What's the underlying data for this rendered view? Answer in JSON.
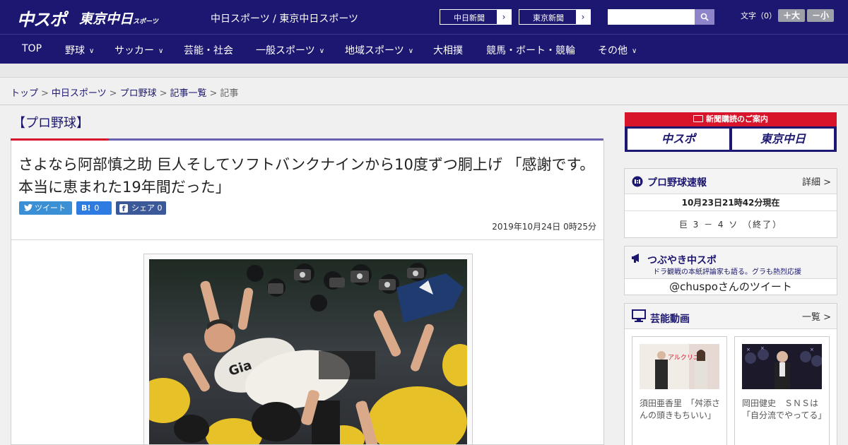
{
  "header": {
    "logo_main": "中スポ",
    "logo_tokyo": "東京中日",
    "logo_tokyo_small": "スポーツ",
    "site_title": "中日スポーツ / 東京中日スポーツ",
    "chunichi_btn": "中日新聞",
    "tokyo_btn": "東京新聞",
    "search_placeholder": "",
    "font_label": "文字（0）",
    "font_up": "＋大",
    "font_down": "－小"
  },
  "nav": [
    {
      "label": "TOP",
      "chevron": false
    },
    {
      "label": "野球",
      "chevron": true
    },
    {
      "label": "サッカー",
      "chevron": true
    },
    {
      "label": "芸能・社会",
      "chevron": false
    },
    {
      "label": "一般スポーツ",
      "chevron": true
    },
    {
      "label": "地域スポーツ",
      "chevron": true
    },
    {
      "label": "大相撲",
      "chevron": false
    },
    {
      "label": "競馬・ボート・競輪",
      "chevron": false
    },
    {
      "label": "その他",
      "chevron": true
    }
  ],
  "breadcrumb": {
    "items": [
      "トップ",
      "中日スポーツ",
      "プロ野球",
      "記事一覧"
    ],
    "current": "記事",
    "separator": ">"
  },
  "article": {
    "category": "【プロ野球】",
    "headline": "さよなら阿部慎之助 巨人そしてソフトバンクナインから10度ずつ胴上げ 「感謝です。本当に恵まれた19年間だった」",
    "tweet_label": "ツイート",
    "hatena_count": "0",
    "share_label": "シェア",
    "share_count": "0",
    "datetime": "2019年10月24日 0時25分"
  },
  "sidebar": {
    "promo_title": "新聞購読のご案内",
    "promo_logo_1": "中スポ",
    "promo_logo_2": "東京中日",
    "score": {
      "title": "プロ野球速報",
      "more": "詳細 >",
      "time": "10月23日21時42分現在",
      "line": "巨 3 － 4 ソ （終了）"
    },
    "tsubuyaki": {
      "title": "つぶやき中スポ",
      "sub": "ドラ観戦の本紙評論家も語る。グラも熱烈応援",
      "tweets": "@chuspoさんのツイート"
    },
    "video": {
      "title": "芸能動画",
      "more": "一覧 >",
      "items": [
        {
          "caption": "須田亜香里　「舛添さんの頭きもちいい」"
        },
        {
          "caption": "岡田健史　ＳＮＳは「自分流でやってる」"
        }
      ]
    }
  },
  "colors": {
    "brand": "#1c1770",
    "accent_red": "#d7142a",
    "twitter": "#3a8fd5",
    "hatena": "#2e7ce1",
    "facebook": "#3b5998"
  }
}
